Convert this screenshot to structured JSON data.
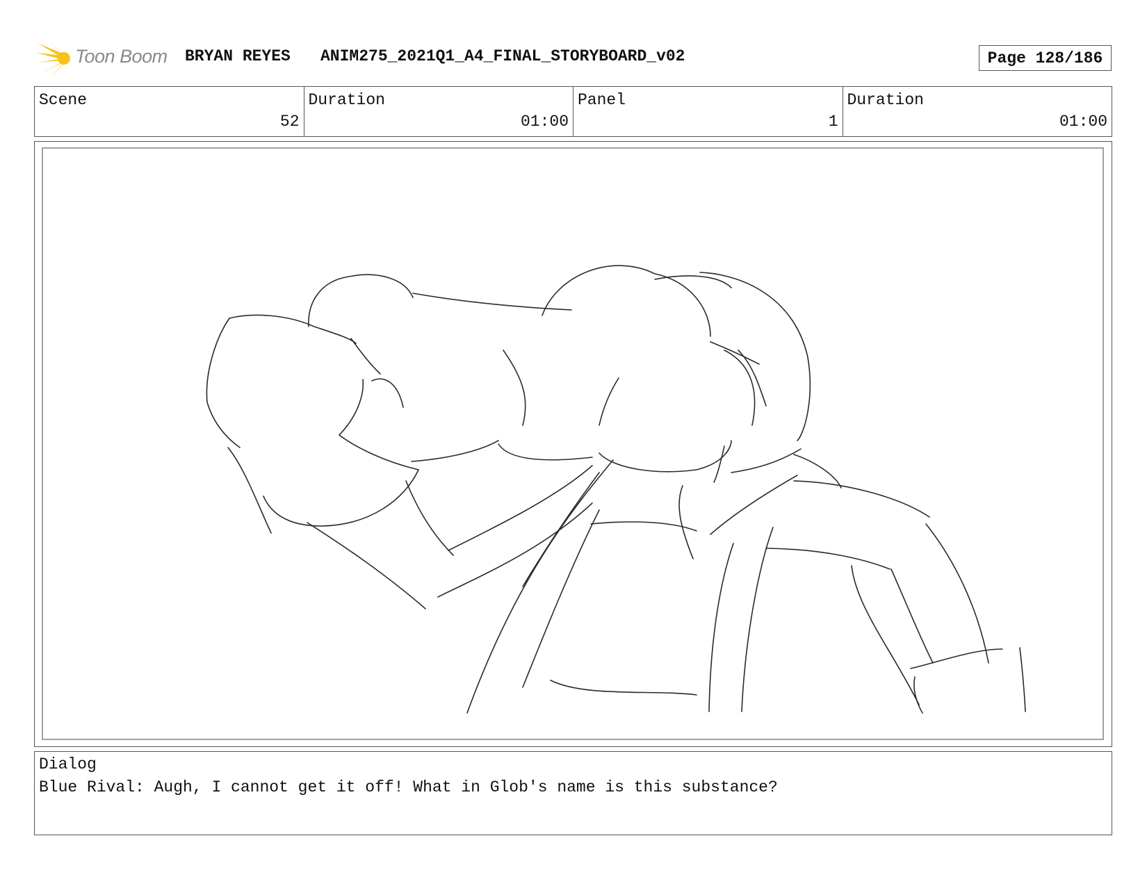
{
  "header": {
    "logo_text": "Toon Boom",
    "author": "BRYAN REYES",
    "title": "ANIM275_2021Q1_A4_FINAL_STORYBOARD_v02",
    "page": "Page 128/186"
  },
  "info": {
    "scene_label": "Scene",
    "scene_value": "52",
    "scene_duration_label": "Duration",
    "scene_duration_value": "01:00",
    "panel_label": "Panel",
    "panel_value": "1",
    "panel_duration_label": "Duration",
    "panel_duration_value": "01:00"
  },
  "panel": {
    "drawing": "rough pencil sketch"
  },
  "dialog": {
    "label": "Dialog",
    "text": "Blue Rival: Augh, I cannot get it off! What in Glob's name is this substance?"
  },
  "colors": {
    "logo_accent": "#f7c21a",
    "logo_text": "#8a8a8a",
    "border": "#555555",
    "panel_frame": "#a0a0a0"
  }
}
